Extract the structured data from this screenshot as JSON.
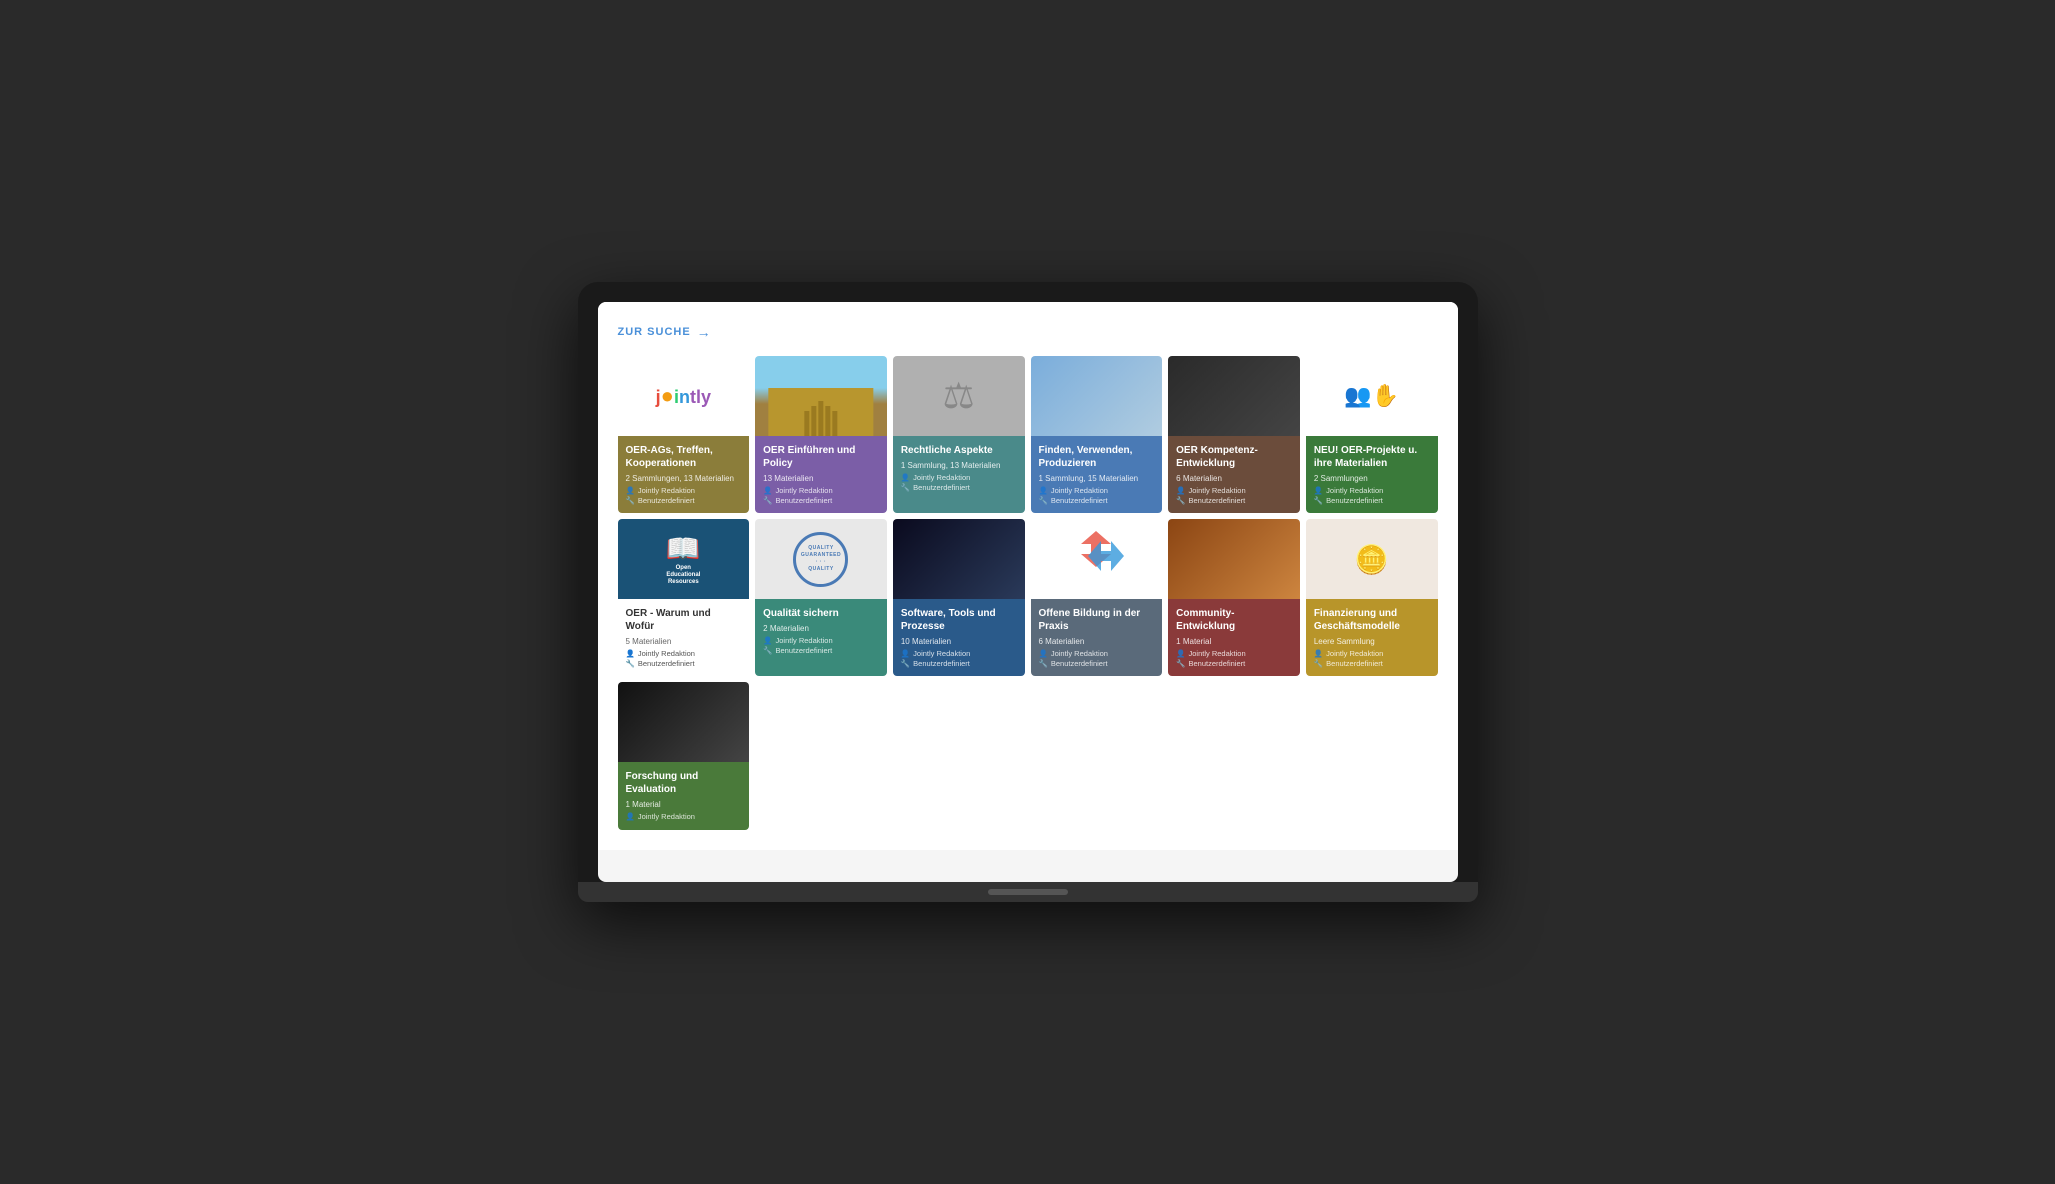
{
  "nav": {
    "zur_suche": "ZUR SUCHE"
  },
  "cards": [
    {
      "id": "oer-ags",
      "title": "OER-AGs, Treffen, Kooperationen",
      "meta": "2 Sammlungen, 13 Materialien",
      "author": "Jointly Redaktion",
      "type": "Benutzerdefiniert",
      "color": "olive",
      "image_type": "jointly"
    },
    {
      "id": "oer-einfuehren",
      "title": "OER Einführen und Policy",
      "meta": "13 Materialien",
      "author": "Jointly Redaktion",
      "type": "Benutzerdefiniert",
      "color": "purple",
      "image_type": "parliament"
    },
    {
      "id": "rechtliche",
      "title": "Rechtliche Aspekte",
      "meta": "1 Sammlung, 13 Materialien",
      "author": "Jointly Redaktion",
      "type": "Benutzerdefiniert",
      "color": "teal",
      "image_type": "law"
    },
    {
      "id": "finden-verwenden",
      "title": "Finden, Verwenden, Produzieren",
      "meta": "1 Sammlung, 15 Materialien",
      "author": "Jointly Redaktion",
      "type": "Benutzerdefiniert",
      "color": "blue",
      "image_type": "laptop"
    },
    {
      "id": "oer-kompetenz",
      "title": "OER Kompetenz-Entwicklung",
      "meta": "6 Materialien",
      "author": "Jointly Redaktion",
      "type": "Benutzerdefiniert",
      "color": "brown",
      "image_type": "thumbsup"
    },
    {
      "id": "oer-projekte",
      "title": "NEU! OER-Projekte u. ihre Materialien",
      "meta": "2 Sammlungen",
      "author": "Jointly Redaktion",
      "type": "Benutzerdefiniert",
      "color": "green",
      "image_type": "people"
    },
    {
      "id": "oer-warum",
      "title": "OER - Warum und Wofür",
      "meta": "5 Materialien",
      "author": "Jointly Redaktion",
      "type": "Benutzerdefiniert",
      "color": "white",
      "image_type": "oer"
    },
    {
      "id": "qualitaet",
      "title": "Qualität sichern",
      "meta": "2 Materialien",
      "author": "Jointly Redaktion",
      "type": "Benutzerdefiniert",
      "color": "teal2",
      "image_type": "quality"
    },
    {
      "id": "software",
      "title": "Software, Tools und Prozesse",
      "meta": "10 Materialien",
      "author": "Jointly Redaktion",
      "type": "Benutzerdefiniert",
      "color": "darkblue",
      "image_type": "server"
    },
    {
      "id": "offene-bildung",
      "title": "Offene Bildung in der Praxis",
      "meta": "6 Materialien",
      "author": "Jointly Redaktion",
      "type": "Benutzerdefiniert",
      "color": "slate",
      "image_type": "arrows"
    },
    {
      "id": "community",
      "title": "Community-Entwicklung",
      "meta": "1 Material",
      "author": "Jointly Redaktion",
      "type": "Benutzerdefiniert",
      "color": "red",
      "image_type": "hands"
    },
    {
      "id": "finanzierung",
      "title": "Finanzierung und Geschäftsmodelle",
      "meta": "Leere Sammlung",
      "author": "Jointly Redaktion",
      "type": "Benutzerdefiniert",
      "color": "yellow",
      "image_type": "coin"
    },
    {
      "id": "forschung",
      "title": "Forschung und Evaluation",
      "meta": "1 Material",
      "author": "Jointly Redaktion",
      "type": "",
      "color": "green2",
      "image_type": "writing"
    }
  ]
}
